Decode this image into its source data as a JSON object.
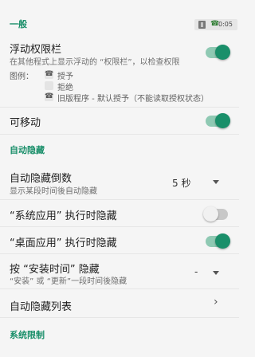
{
  "sections": {
    "general": "一般",
    "auto_hide": "自动隐藏",
    "system_limits": "系统限制"
  },
  "status_pill": {
    "time": "0:05",
    "box_icon": "square-icon",
    "phone_icon": "phone-icon"
  },
  "floating_bar": {
    "title": "浮动权限栏",
    "subtitle": "在其他程式上显示浮动的 “权限栏”，以检查权限",
    "enabled": true
  },
  "legend": {
    "label": "图例：",
    "items": [
      {
        "icon": "phone-icon",
        "text": "授予"
      },
      {
        "icon": "blank-icon",
        "text": "拒绝"
      },
      {
        "icon": "phone-icon",
        "text": "旧版程序 - 默认授予（不能读取授权状态）"
      }
    ]
  },
  "movable": {
    "title": "可移动",
    "enabled": true
  },
  "auto_hide_countdown": {
    "title": "自动隐藏倒数",
    "subtitle": "显示某段时间後自动隐藏",
    "value": "5 秒"
  },
  "system_apps": {
    "title": "“系统应用” 执行时隐藏",
    "enabled": false
  },
  "desktop_apps": {
    "title": "“桌面应用” 执行时隐藏",
    "enabled": true
  },
  "install_time": {
    "title": "按 “安装时间” 隐藏",
    "subtitle": "“安装” 或 “更新”一段时间後隐藏",
    "value": "-"
  },
  "auto_hide_list": {
    "title": "自动隐藏列表"
  },
  "colors": {
    "accent": "#1a8f6a",
    "switch_track_on": "#8fc9b3",
    "background": "#f5f5f5"
  }
}
